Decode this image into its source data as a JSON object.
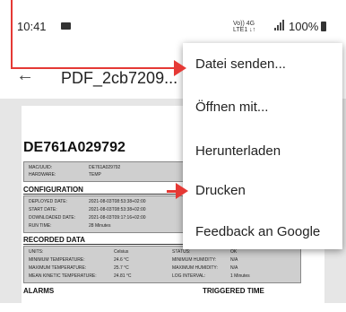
{
  "status": {
    "time": "10:41",
    "network": "Vo)) 4G",
    "lte": "LTE1 ↓↑",
    "battery": "100%"
  },
  "toolbar": {
    "title": "PDF_2cb7209..."
  },
  "document": {
    "title": "DE761A029792",
    "rows_top": [
      {
        "k": "MAC/UUID:",
        "v": "DE761A029792"
      },
      {
        "k": "HARDWARE:",
        "v": "TEMP"
      }
    ],
    "configuration": {
      "heading": "CONFIGURATION",
      "rows": [
        {
          "k": "DEPLOYED DATE:",
          "v": "2021-08-03T08:53:38+02:00"
        },
        {
          "k": "START DATE:",
          "v": "2021-08-03T08:53:38+02:00"
        },
        {
          "k": "DOWNLOADED DATE:",
          "v": "2021-08-03T09:17:16+02:00"
        },
        {
          "k": "RUN TIME:",
          "v": "28 Minutes"
        }
      ]
    },
    "recorded": {
      "heading": "RECORDED DATA",
      "rows": [
        {
          "k": "UNITS:",
          "v": "Celsius",
          "k2": "STATUS:",
          "v2": "OK"
        },
        {
          "k": "MINIMUM TEMPERATURE:",
          "v": "24.6 °C",
          "k2": "MINIMUM HUMIDITY:",
          "v2": "N/A"
        },
        {
          "k": "MAXIMUM TEMPERATURE:",
          "v": "25.7 °C",
          "k2": "MAXIMUM HUMIDITY:",
          "v2": "N/A"
        },
        {
          "k": "MEAN KINETIC TEMPERATURE:",
          "v": "24.81 °C",
          "k2": "LOG INTERVAL:",
          "v2": "1 Minutes"
        }
      ]
    },
    "alarms": {
      "heading": "ALARMS",
      "col2": "TRIGGERED TIME"
    }
  },
  "menu": {
    "items": [
      {
        "label": "Datei senden..."
      },
      {
        "label": "Öffnen mit..."
      },
      {
        "label": "Herunterladen"
      },
      {
        "label": "Drucken"
      },
      {
        "label": "Feedback an Google"
      }
    ]
  },
  "colors": {
    "annotation": "#e53935"
  }
}
